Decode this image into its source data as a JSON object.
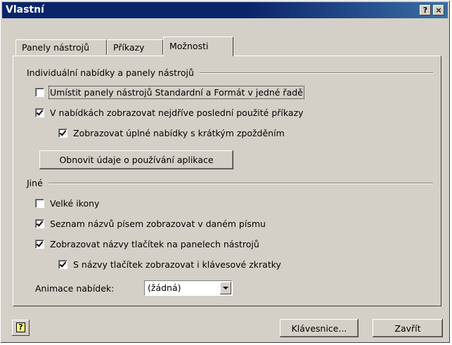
{
  "window": {
    "title": "Vlastní",
    "help_glyph": "?",
    "close_glyph": "×"
  },
  "tabs": [
    {
      "label": "Panely nástrojů",
      "active": false
    },
    {
      "label": "Příkazy",
      "active": false
    },
    {
      "label": "Možnosti",
      "active": true
    }
  ],
  "section1": {
    "title": "Individuální nabídky a panely nástrojů",
    "checkboxes": [
      {
        "label": "Umístit panely nástrojů Standardní a Formát v jedné řadě",
        "checked": false
      },
      {
        "label": "V nabídkách zobrazovat nejdříve poslední použité příkazy",
        "checked": true
      },
      {
        "label": "Zobrazovat úplné nabídky s krátkým zpožděním",
        "checked": true
      }
    ],
    "reset_button": "Obnovit údaje o používání aplikace"
  },
  "section2": {
    "title": "Jiné",
    "checkboxes": [
      {
        "label": "Velké ikony",
        "checked": false
      },
      {
        "label": "Seznam názvů písem zobrazovat v daném písmu",
        "checked": true
      },
      {
        "label": "Zobrazovat názvy tlačítek na panelech nástrojů",
        "checked": true
      },
      {
        "label": "S názvy tlačítek zobrazovat i klávesové zkratky",
        "checked": true
      }
    ],
    "animation": {
      "label": "Animace nabídek:",
      "value": "(žádná)"
    }
  },
  "footer": {
    "help_icon_glyph": "?",
    "keyboard_button": "Klávesnice...",
    "close_button": "Zavřít"
  }
}
